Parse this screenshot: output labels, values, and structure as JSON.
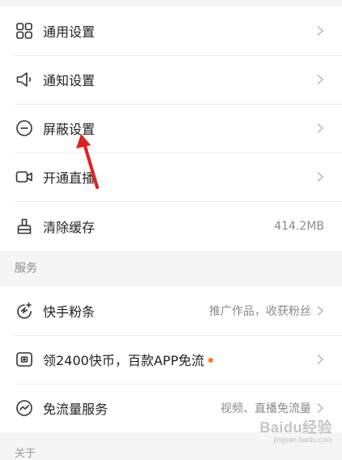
{
  "settings": {
    "general": {
      "label": "通用设置",
      "icon": "grid-icon"
    },
    "notification": {
      "label": "通知设置",
      "icon": "speaker-icon"
    },
    "block": {
      "label": "屏蔽设置",
      "icon": "block-icon"
    },
    "live": {
      "label": "开通直播",
      "icon": "video-camera-icon"
    },
    "cache": {
      "label": "清除缓存",
      "value": "414.2MB",
      "icon": "brush-icon"
    }
  },
  "services": {
    "header": "服务",
    "fans": {
      "label": "快手粉条",
      "value": "推广作品，收获粉丝",
      "icon": "rocket-icon"
    },
    "coins": {
      "label": "领2400快币，百款APP免流",
      "icon": "coin-icon"
    },
    "free_data": {
      "label": "免流量服务",
      "value": "视频、直播免流量",
      "icon": "signal-icon"
    }
  },
  "footer_partial": "关于",
  "watermark": {
    "main": "Baidu经验",
    "sub": "jingyan.baidu.com"
  },
  "colors": {
    "accent_dot": "#ff7a1a",
    "arrow": "#e02020"
  }
}
